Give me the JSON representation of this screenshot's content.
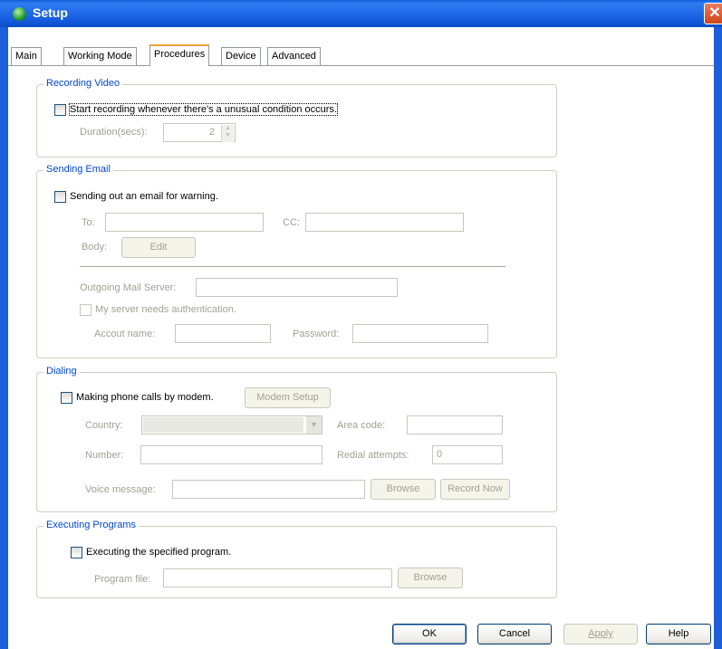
{
  "window": {
    "title": "Setup"
  },
  "tabs": [
    {
      "label": "Main"
    },
    {
      "label": "Working Mode"
    },
    {
      "label": "Procedures"
    },
    {
      "label": "Device"
    },
    {
      "label": "Advanced"
    }
  ],
  "recording_video": {
    "title": "Recording Video",
    "checkbox_label": "Start recording whenever there's a unusual condition occurs.",
    "checked": false,
    "duration_label": "Duration(secs):",
    "duration_value": "2"
  },
  "sending_email": {
    "title": "Sending Email",
    "checkbox_label": "Sending out an email for warning.",
    "checked": false,
    "to_label": "To:",
    "cc_label": "CC:",
    "body_label": "Body:",
    "edit_button": "Edit",
    "mail_server_label": "Outgoing Mail Server:",
    "auth_label": "My server needs authentication.",
    "account_label": "Accout name:",
    "password_label": "Password:"
  },
  "dialing": {
    "title": "Dialing",
    "checkbox_label": "Making phone calls by modem.",
    "checked": false,
    "modem_setup_button": "Modem Setup",
    "country_label": "Country:",
    "area_code_label": "Area code:",
    "number_label": "Number:",
    "redial_label": "Redial attempts:",
    "redial_value": "0",
    "voice_label": "Voice message:",
    "browse_button": "Browse",
    "record_button": "Record Now"
  },
  "executing_programs": {
    "title": "Executing Programs",
    "checkbox_label": "Executing the specified program.",
    "checked": false,
    "program_label": "Program file:",
    "browse_button": "Browse"
  },
  "footer": {
    "ok": "OK",
    "cancel": "Cancel",
    "apply": "Apply",
    "help": "Help"
  }
}
